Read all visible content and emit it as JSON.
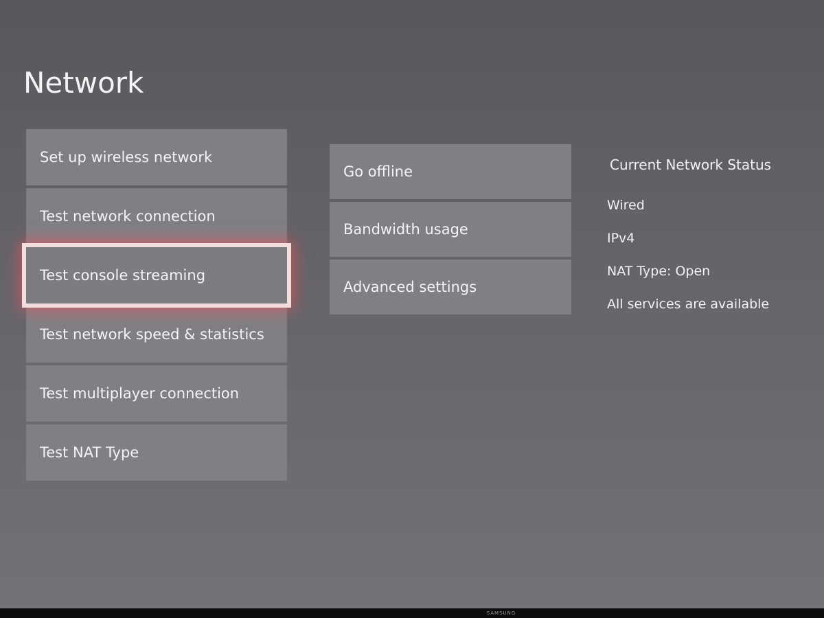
{
  "page": {
    "title": "Network"
  },
  "menu_left": {
    "items": [
      {
        "label": "Set up wireless network"
      },
      {
        "label": "Test network connection"
      },
      {
        "label": "Test console streaming",
        "focused": true
      },
      {
        "label": "Test network speed & statistics"
      },
      {
        "label": "Test multiplayer connection"
      },
      {
        "label": "Test NAT Type"
      }
    ]
  },
  "menu_mid": {
    "items": [
      {
        "label": "Go offline"
      },
      {
        "label": "Bandwidth usage"
      },
      {
        "label": "Advanced settings"
      }
    ]
  },
  "status": {
    "heading": "Current Network Status",
    "lines": [
      "Wired",
      "IPv4",
      "NAT Type: Open",
      "All services are available"
    ]
  },
  "tv": {
    "brand": "SAMSUNG"
  },
  "colors": {
    "focus_glow": "#eb505a",
    "tile_bg": "#807f84",
    "screen_bg": "#646369"
  }
}
